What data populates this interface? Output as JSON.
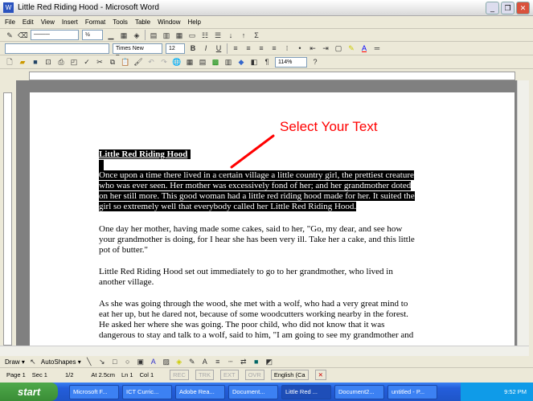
{
  "window": {
    "title": "Little Red Riding Hood - Microsoft Word",
    "app_icon": "W"
  },
  "menu": [
    "File",
    "Edit",
    "View",
    "Insert",
    "Format",
    "Tools",
    "Table",
    "Window",
    "Help"
  ],
  "toolbar_tables": {
    "line_weight": "½"
  },
  "formatting": {
    "style": "",
    "font": "Times New Roman",
    "size": "12",
    "bold": "B",
    "italic": "I",
    "underline": "U"
  },
  "standard": {
    "zoom": "114%",
    "pilcrow": "¶"
  },
  "document": {
    "title": "Little Red Riding Hood",
    "paragraphs": [
      [
        "Once upon a time there lived in a certain village a little country girl, the prettiest creature",
        "who was ever seen. Her mother was excessively fond of her; and her grandmother doted",
        "on her still more. This good woman had a little red riding hood made for her. It suited the",
        "girl so extremely well that everybody called her Little Red Riding Hood."
      ],
      [
        "One day her mother, having made some cakes, said to her, \"Go, my dear, and see how",
        "your grandmother is doing, for I hear she has been very ill. Take her a cake, and this little",
        "pot of butter.\""
      ],
      [
        "Little Red Riding Hood set out immediately to go to her grandmother, who lived in",
        "another village."
      ],
      [
        "As she was going through the wood, she met with a wolf, who had a very great mind to",
        "eat her up, but he dared not, because of some woodcutters working nearby in the forest.",
        "He asked her where she was going. The poor child, who did not know that it was",
        "dangerous to stay and talk to a wolf, said to him, \"I am going to see my grandmother and"
      ]
    ]
  },
  "annotation": {
    "text": "Select Your Text",
    "color": "#ff0000"
  },
  "drawing": {
    "draw": "Draw ▾",
    "autoshapes": "AutoShapes ▾"
  },
  "status": {
    "page": "Page 1",
    "sec": "Sec 1",
    "pages": "1/2",
    "at": "At 2.5cm",
    "ln": "Ln 1",
    "col": "Col 1",
    "rec": "REC",
    "trk": "TRK",
    "ext": "EXT",
    "ovr": "OVR",
    "lang": "English (Ca"
  },
  "taskbar": {
    "start": "start",
    "tasks": [
      "Microsoft F...",
      "ICT Curric...",
      "Adobe Rea...",
      "Document...",
      "Little Red ...",
      "Document2...",
      "untitled - P..."
    ],
    "clock": "9:52 PM"
  }
}
